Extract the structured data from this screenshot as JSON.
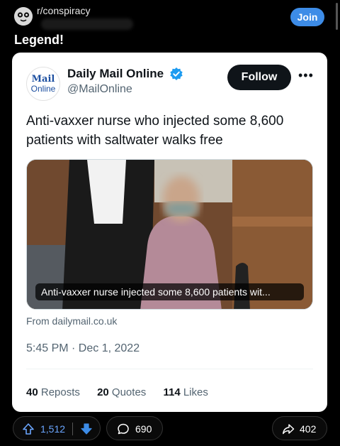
{
  "header": {
    "subreddit": "r/conspiracy",
    "join_label": "Join"
  },
  "post": {
    "title": "Legend!"
  },
  "tweet": {
    "logo_line1": "Mail",
    "logo_line2": "Online",
    "account_name": "Daily Mail Online",
    "handle": "@MailOnline",
    "follow_label": "Follow",
    "more_label": "•••",
    "text": "Anti-vaxxer nurse who injected some 8,600 patients with saltwater walks free",
    "media_caption": "Anti-vaxxer nurse injected some 8,600 patients wit...",
    "source": "From dailymail.co.uk",
    "timestamp": "5:45 PM · Dec 1, 2022",
    "stats": {
      "reposts_count": "40",
      "reposts_label": "Reposts",
      "quotes_count": "20",
      "quotes_label": "Quotes",
      "likes_count": "114",
      "likes_label": "Likes"
    }
  },
  "actions": {
    "upvotes": "1,512",
    "comments": "690",
    "shares": "402"
  },
  "colors": {
    "join_blue": "#3d8ce7",
    "upvote_blue": "#6ba6ff",
    "verified_blue": "#1d9bf0"
  },
  "icons": [
    "subreddit-avatar-icon",
    "verified-badge-icon",
    "more-icon",
    "upvote-icon",
    "downvote-icon",
    "comment-icon",
    "share-icon"
  ]
}
